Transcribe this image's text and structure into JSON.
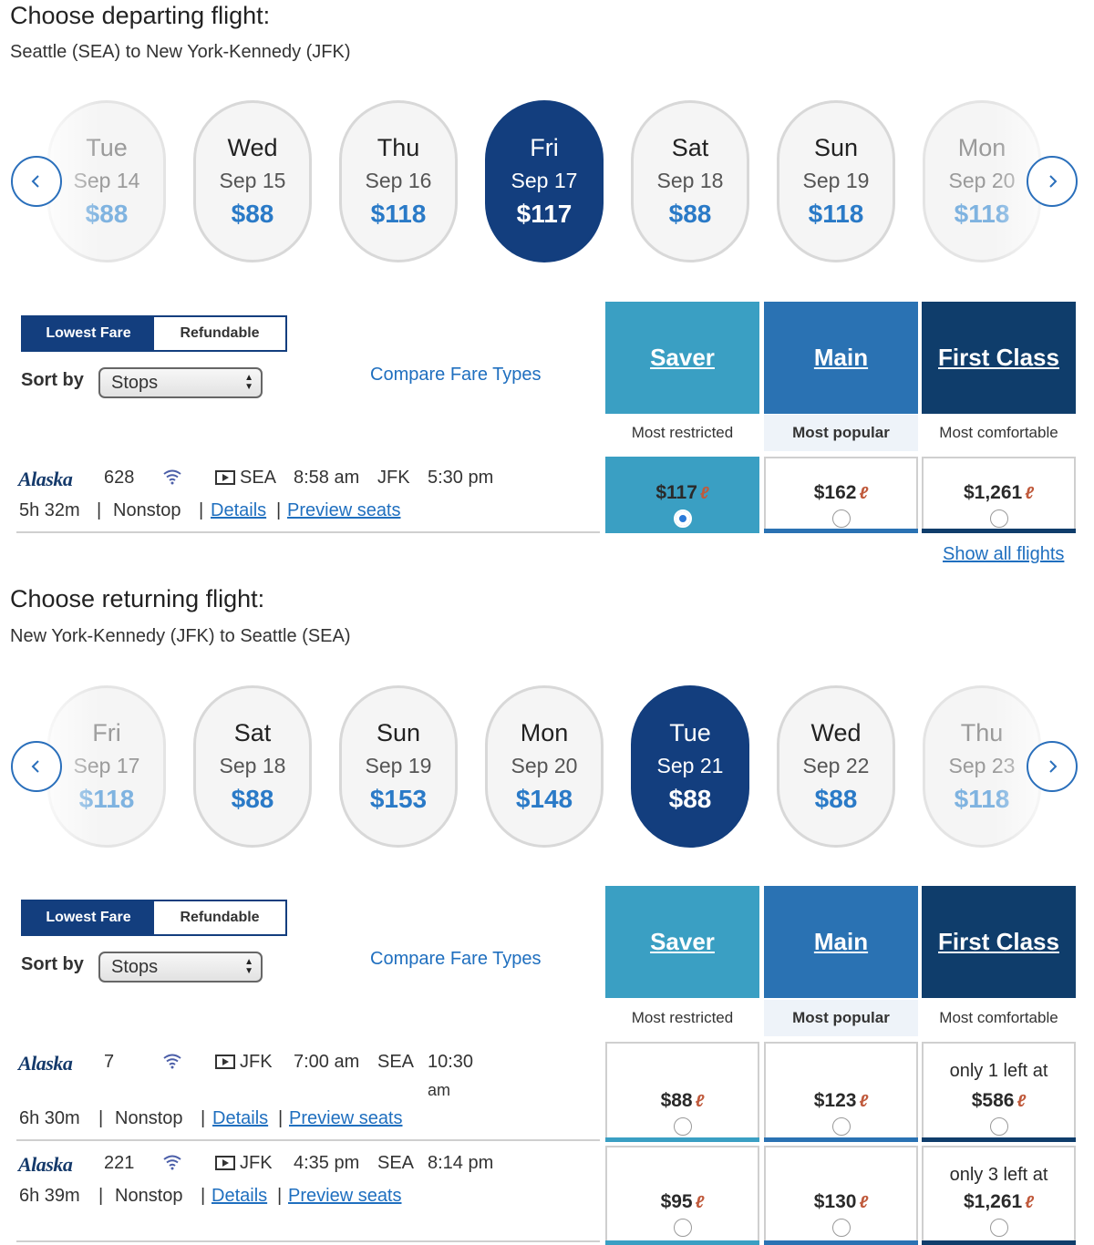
{
  "departing": {
    "title": "Choose departing flight:",
    "route": "Seattle (SEA) to New York-Kennedy (JFK)",
    "dates": [
      {
        "day": "Tue",
        "date": "Sep 14",
        "price": "$88"
      },
      {
        "day": "Wed",
        "date": "Sep 15",
        "price": "$88"
      },
      {
        "day": "Thu",
        "date": "Sep 16",
        "price": "$118"
      },
      {
        "day": "Fri",
        "date": "Sep 17",
        "price": "$117"
      },
      {
        "day": "Sat",
        "date": "Sep 18",
        "price": "$88"
      },
      {
        "day": "Sun",
        "date": "Sep 19",
        "price": "$118"
      },
      {
        "day": "Mon",
        "date": "Sep 20",
        "price": "$118"
      }
    ],
    "selected_date": "Fri Sep 17",
    "fare_toggle": {
      "lowest": "Lowest Fare",
      "refundable": "Refundable"
    },
    "sort_label": "Sort by",
    "sort_value": "Stops",
    "compare_link": "Compare Fare Types",
    "fare_types": [
      {
        "name": "Saver",
        "desc": "Most restricted"
      },
      {
        "name": "Main",
        "desc": "Most popular"
      },
      {
        "name": "First Class",
        "desc": "Most comfortable"
      }
    ],
    "flights": [
      {
        "airline": "Alaska",
        "number": "628",
        "from": "SEA",
        "depart": "8:58 am",
        "to": "JFK",
        "arrive": "5:30 pm",
        "duration": "5h 32m",
        "stops": "Nonstop",
        "details": "Details",
        "preview": "Preview seats",
        "prices": [
          {
            "amount": "$117",
            "note": "",
            "selected": true
          },
          {
            "amount": "$162",
            "note": "",
            "selected": false
          },
          {
            "amount": "$1,261",
            "note": "",
            "selected": false
          }
        ]
      }
    ],
    "show_all": "Show all flights"
  },
  "returning": {
    "title": "Choose returning flight:",
    "route": "New York-Kennedy (JFK) to Seattle (SEA)",
    "dates": [
      {
        "day": "Fri",
        "date": "Sep 17",
        "price": "$118"
      },
      {
        "day": "Sat",
        "date": "Sep 18",
        "price": "$88"
      },
      {
        "day": "Sun",
        "date": "Sep 19",
        "price": "$153"
      },
      {
        "day": "Mon",
        "date": "Sep 20",
        "price": "$148"
      },
      {
        "day": "Tue",
        "date": "Sep 21",
        "price": "$88"
      },
      {
        "day": "Wed",
        "date": "Sep 22",
        "price": "$88"
      },
      {
        "day": "Thu",
        "date": "Sep 23",
        "price": "$118"
      }
    ],
    "selected_date": "Tue Sep 21",
    "fare_toggle": {
      "lowest": "Lowest Fare",
      "refundable": "Refundable"
    },
    "sort_label": "Sort by",
    "sort_value": "Stops",
    "compare_link": "Compare Fare Types",
    "fare_types": [
      {
        "name": "Saver",
        "desc": "Most restricted"
      },
      {
        "name": "Main",
        "desc": "Most popular"
      },
      {
        "name": "First Class",
        "desc": "Most comfortable"
      }
    ],
    "flights": [
      {
        "airline": "Alaska",
        "number": "7",
        "from": "JFK",
        "depart": "7:00 am",
        "to": "SEA",
        "arrive": "10:30",
        "arrive_suffix": "am",
        "duration": "6h 30m",
        "stops": "Nonstop",
        "details": "Details",
        "preview": "Preview seats",
        "prices": [
          {
            "amount": "$88",
            "note": "",
            "selected": false
          },
          {
            "amount": "$123",
            "note": "",
            "selected": false
          },
          {
            "amount": "$586",
            "note": "only 1 left at",
            "selected": false
          }
        ]
      },
      {
        "airline": "Alaska",
        "number": "221",
        "from": "JFK",
        "depart": "4:35 pm",
        "to": "SEA",
        "arrive": "8:14 pm",
        "duration": "6h 39m",
        "stops": "Nonstop",
        "details": "Details",
        "preview": "Preview seats",
        "prices": [
          {
            "amount": "$95",
            "note": "",
            "selected": false
          },
          {
            "amount": "$130",
            "note": "",
            "selected": false
          },
          {
            "amount": "$1,261",
            "note": "only 3 left at",
            "selected": false
          }
        ]
      }
    ]
  },
  "colors": {
    "selected_date": "#133e7e",
    "price_blue": "#2a7ac7",
    "saver": "#3a9fc3",
    "main": "#2a72b3",
    "first_class": "#0f3d6b",
    "link": "#1f6fbf",
    "mileage_icon": "#c05a3c"
  },
  "icons": {
    "prev": "chevron-left-icon",
    "next": "chevron-right-icon",
    "wifi": "wifi-icon",
    "entertainment": "streaming-video-icon",
    "mileage": "mileage-plan-icon"
  }
}
